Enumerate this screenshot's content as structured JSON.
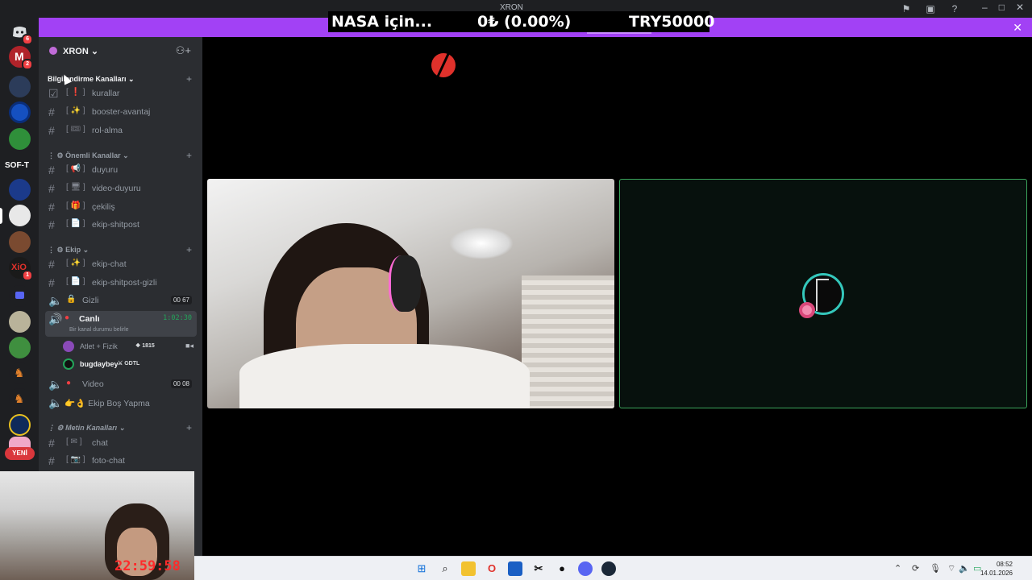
{
  "window": {
    "title": "XRON"
  },
  "ticker": {
    "left": "NASA için...",
    "middle": "0₺ (0.00%)",
    "right": "TRY50000"
  },
  "rail": {
    "sof_label": "SOF-T",
    "yeni_label": "YENİ",
    "badge_discord": "6",
    "badge_m": "2",
    "badge_xio": "1"
  },
  "server": {
    "name": "XRON"
  },
  "categories": {
    "c1": "Bilgilendirme Kanalları",
    "c2": "Önemli Kanallar",
    "c3": "Ekip",
    "c4": "Metin Kanalları"
  },
  "channels": {
    "kurallar": "kurallar",
    "booster": "booster-avantaj",
    "rol": "rol-alma",
    "duyuru": "duyuru",
    "video_duyuru": "video-duyuru",
    "cekilis": "çekiliş",
    "ekip_shitpost": "ekip-shitpost",
    "ekip_chat": "ekip-chat",
    "ekip_shitpost_gizli": "ekip-shitpost-gizli",
    "gizli": "Gizli",
    "gizli_count_a": "00",
    "gizli_count_b": "67",
    "canli": "Canlı",
    "canli_timer": "1:02:30",
    "canli_status": "Bir kanal durumu belirle",
    "video": "Video",
    "video_count_a": "00",
    "video_count_b": "08",
    "ekip_bos": "👉👌 Ekip Boş Yapma",
    "chat": "chat",
    "foto_chat": "foto-chat"
  },
  "members": {
    "m1_name": "Atlet + Fizik",
    "m1_tag": "1815",
    "m2_name": "bugdaybey",
    "m2_tag": "GDTL"
  },
  "selfcam": {
    "clock": "22:59:58"
  },
  "taskbar": {
    "time": "08:52",
    "date": "14.01.2026"
  },
  "icons": [
    "discord-icon",
    "search-icon",
    "folder-icon",
    "opera-icon",
    "store-icon",
    "capcut-icon",
    "steam-icon",
    "gear-icon",
    "mic-icon",
    "wifi-icon",
    "volume-icon",
    "battery-icon"
  ]
}
